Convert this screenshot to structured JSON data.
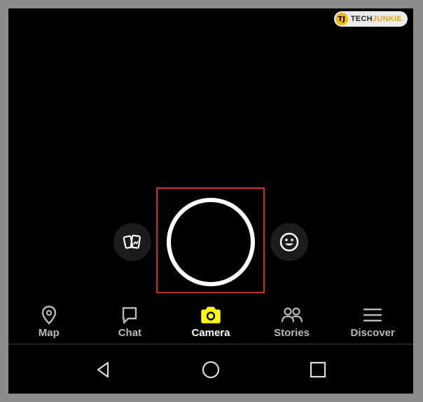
{
  "watermark": {
    "logo": "TJ",
    "brand_prefix": "TECH",
    "brand_suffix": "JUNKIE"
  },
  "camera": {
    "memories_icon": "memories-cards-icon",
    "shutter_icon": "shutter-icon",
    "lens_icon": "smiley-lens-icon",
    "highlight_color": "#d8262c"
  },
  "tabs": [
    {
      "label": "Map",
      "icon": "map-pin-icon",
      "active": false
    },
    {
      "label": "Chat",
      "icon": "chat-bubble-icon",
      "active": false
    },
    {
      "label": "Camera",
      "icon": "camera-icon",
      "active": true
    },
    {
      "label": "Stories",
      "icon": "people-icon",
      "active": false
    },
    {
      "label": "Discover",
      "icon": "hamburger-lines-icon",
      "active": false
    }
  ],
  "colors": {
    "active_tab_icon": "#fffc00",
    "inactive": "#b8b8b8",
    "background": "#000000"
  },
  "system_nav": [
    {
      "icon": "back-triangle-icon"
    },
    {
      "icon": "home-circle-icon"
    },
    {
      "icon": "recents-square-icon"
    }
  ]
}
